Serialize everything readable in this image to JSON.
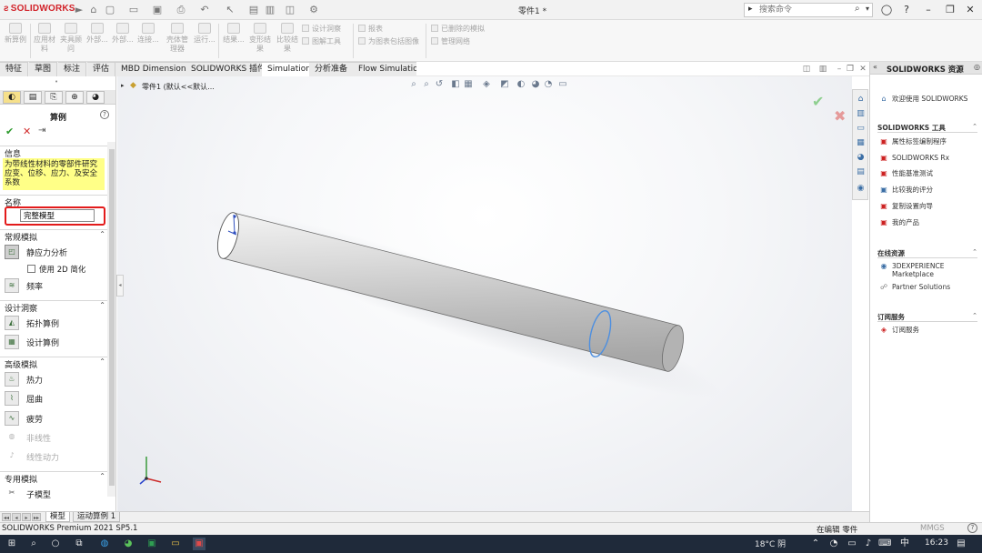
{
  "app": {
    "logo": "SOLIDWORKS",
    "doc_title": "零件1 *",
    "search_placeholder": "搜索命令"
  },
  "command_manager": {
    "buttons": [
      {
        "label": "新算例"
      },
      {
        "label": "应用材\n料"
      },
      {
        "label": "夹具顾\n问"
      },
      {
        "label": "外部..."
      },
      {
        "label": "外部..."
      },
      {
        "label": "连接..."
      },
      {
        "label": "壳体管\n理器"
      },
      {
        "label": "运行..."
      },
      {
        "label": "结果..."
      },
      {
        "label": "变形结\n果"
      },
      {
        "label": "比较结\n果"
      }
    ],
    "small_items": [
      {
        "label": "设计洞察"
      },
      {
        "label": "图解工具"
      },
      {
        "label": "报表"
      },
      {
        "label": "为图表包括图像"
      },
      {
        "label": "已删除的模拟"
      },
      {
        "label": "管理网络"
      }
    ]
  },
  "tabs": [
    "特征",
    "草图",
    "标注",
    "评估",
    "MBD Dimensions",
    "SOLIDWORKS 插件",
    "Simulation",
    "分析准备",
    "Flow Simulation"
  ],
  "active_tab": "Simulation",
  "property_manager": {
    "title": "算例",
    "help": "?",
    "info_header": "信息",
    "info_text": "为带线性材料的零部件研究应变、位移、应力、及安全系数",
    "name_header": "名称",
    "name_value": "完整模型",
    "general_header": "常规模拟",
    "static": "静应力分析",
    "use2d": "使用 2D 简化",
    "frequency": "频率",
    "design_header": "设计洞察",
    "topology": "拓扑算例",
    "design_study": "设计算例",
    "advanced_header": "高级模拟",
    "thermal": "热力",
    "buckling": "屈曲",
    "fatigue": "疲劳",
    "nonlinear": "非线性",
    "linear_dynamic": "线性动力",
    "special_header": "专用模拟",
    "submodel": "子模型"
  },
  "viewport": {
    "feature_label": "零件1  (默认<<默认..."
  },
  "model_tabs": [
    "模型",
    "运动算例 1"
  ],
  "resources": {
    "title": "SOLIDWORKS 资源",
    "welcome": "欢迎使用 SOLIDWORKS",
    "tools_header": "SOLIDWORKS 工具",
    "tools": [
      "属性标签编制程序",
      "SOLIDWORKS Rx",
      "性能基准测试",
      "比较我的评分",
      "复制设置向导",
      "我的产品"
    ],
    "online_header": "在线资源",
    "online": [
      "3DEXPERIENCE Marketplace",
      "Partner Solutions"
    ],
    "subscription_header": "订阅服务",
    "subscription": [
      "订阅服务"
    ]
  },
  "status": {
    "version": "SOLIDWORKS Premium 2021 SP5.1",
    "editing": "在编辑 零件",
    "units": "MMGS",
    "help": "?"
  },
  "taskbar": {
    "weather": "18°C  阴",
    "time": "16:23"
  }
}
